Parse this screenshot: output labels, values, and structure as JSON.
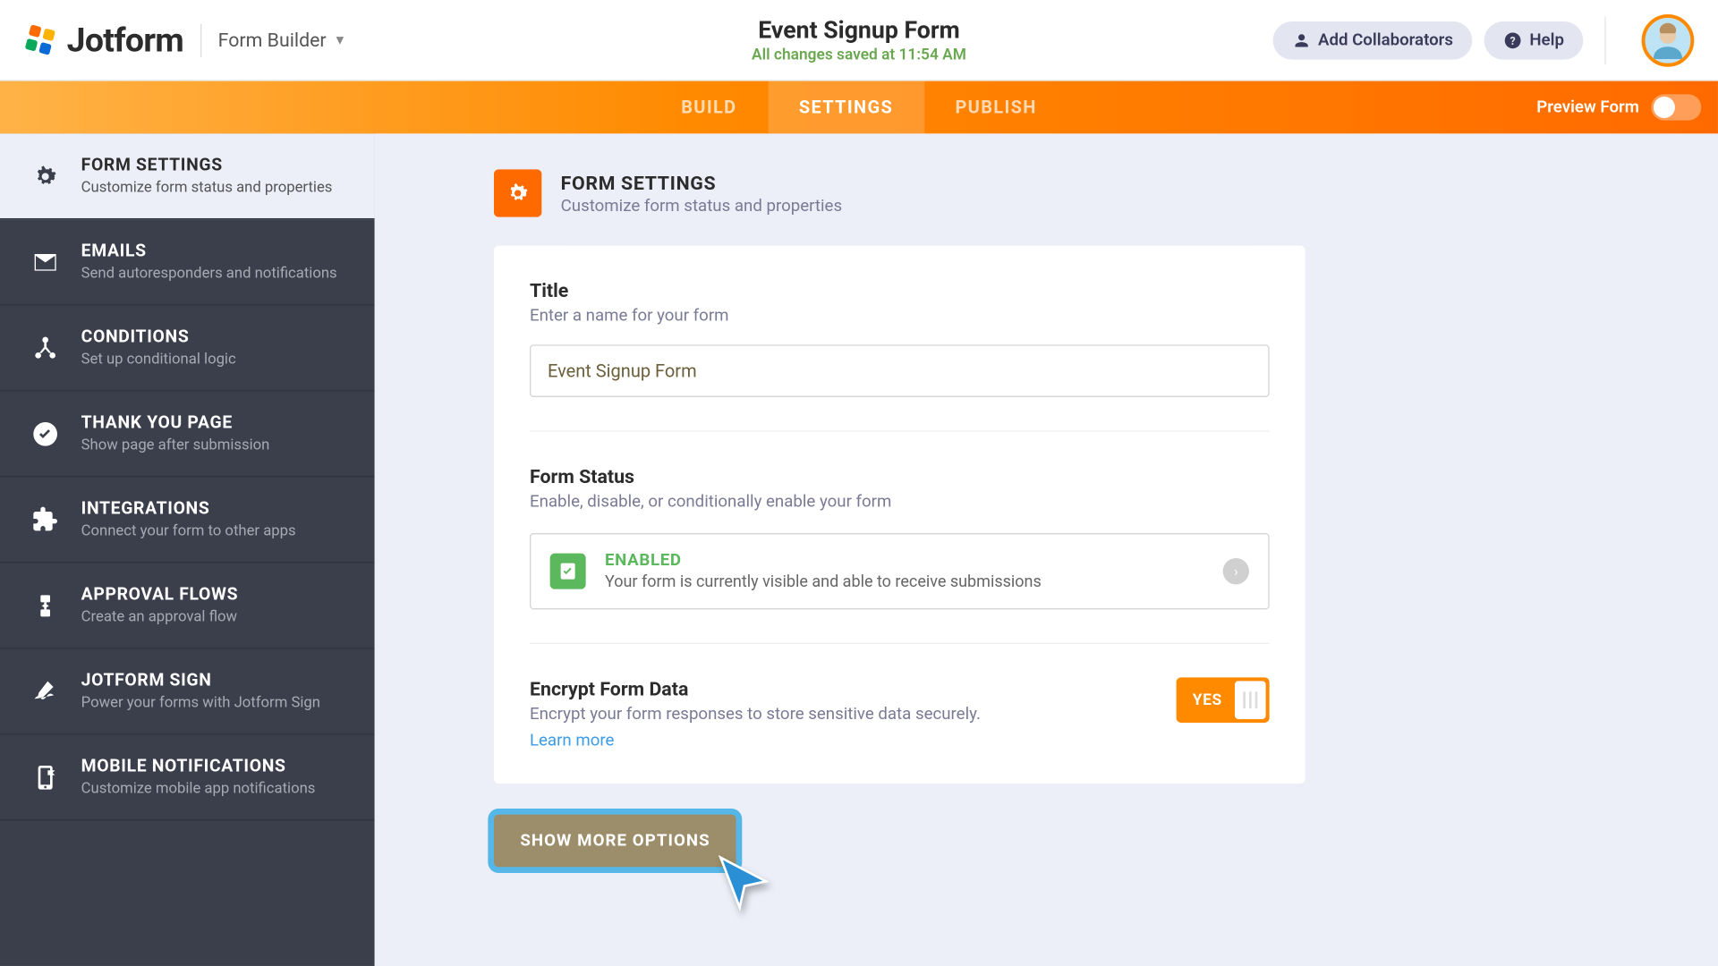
{
  "header": {
    "logo_text": "Jotform",
    "product_label": "Form Builder",
    "form_title": "Event Signup Form",
    "save_status": "All changes saved at 11:54 AM",
    "collaborators_label": "Add Collaborators",
    "help_label": "Help"
  },
  "tabs": {
    "build": "BUILD",
    "settings": "SETTINGS",
    "publish": "PUBLISH",
    "preview_label": "Preview Form"
  },
  "sidebar": [
    {
      "id": "form-settings",
      "title": "FORM SETTINGS",
      "sub": "Customize form status and properties",
      "icon": "gear",
      "active": true
    },
    {
      "id": "emails",
      "title": "EMAILS",
      "sub": "Send autoresponders and notifications",
      "icon": "mail",
      "active": false
    },
    {
      "id": "conditions",
      "title": "CONDITIONS",
      "sub": "Set up conditional logic",
      "icon": "branch",
      "active": false
    },
    {
      "id": "thank-you",
      "title": "THANK YOU PAGE",
      "sub": "Show page after submission",
      "icon": "check",
      "active": false
    },
    {
      "id": "integrations",
      "title": "INTEGRATIONS",
      "sub": "Connect your form to other apps",
      "icon": "puzzle",
      "active": false
    },
    {
      "id": "approval-flows",
      "title": "APPROVAL FLOWS",
      "sub": "Create an approval flow",
      "icon": "flow",
      "active": false
    },
    {
      "id": "jotform-sign",
      "title": "JOTFORM SIGN",
      "sub": "Power your forms with Jotform Sign",
      "icon": "sign",
      "active": false
    },
    {
      "id": "mobile-notifications",
      "title": "MOBILE NOTIFICATIONS",
      "sub": "Customize mobile app notifications",
      "icon": "mobile",
      "active": false
    }
  ],
  "page": {
    "title": "FORM SETTINGS",
    "subtitle": "Customize form status and properties",
    "title_section": {
      "label": "Title",
      "sub": "Enter a name for your form",
      "value": "Event Signup Form"
    },
    "status_section": {
      "label": "Form Status",
      "sub": "Enable, disable, or conditionally enable your form",
      "status_label": "ENABLED",
      "status_desc": "Your form is currently visible and able to receive submissions"
    },
    "encrypt_section": {
      "label": "Encrypt Form Data",
      "sub": "Encrypt your form responses to store sensitive data securely.",
      "learn_more": "Learn more",
      "toggle_label": "YES"
    },
    "show_more": "SHOW MORE OPTIONS"
  }
}
